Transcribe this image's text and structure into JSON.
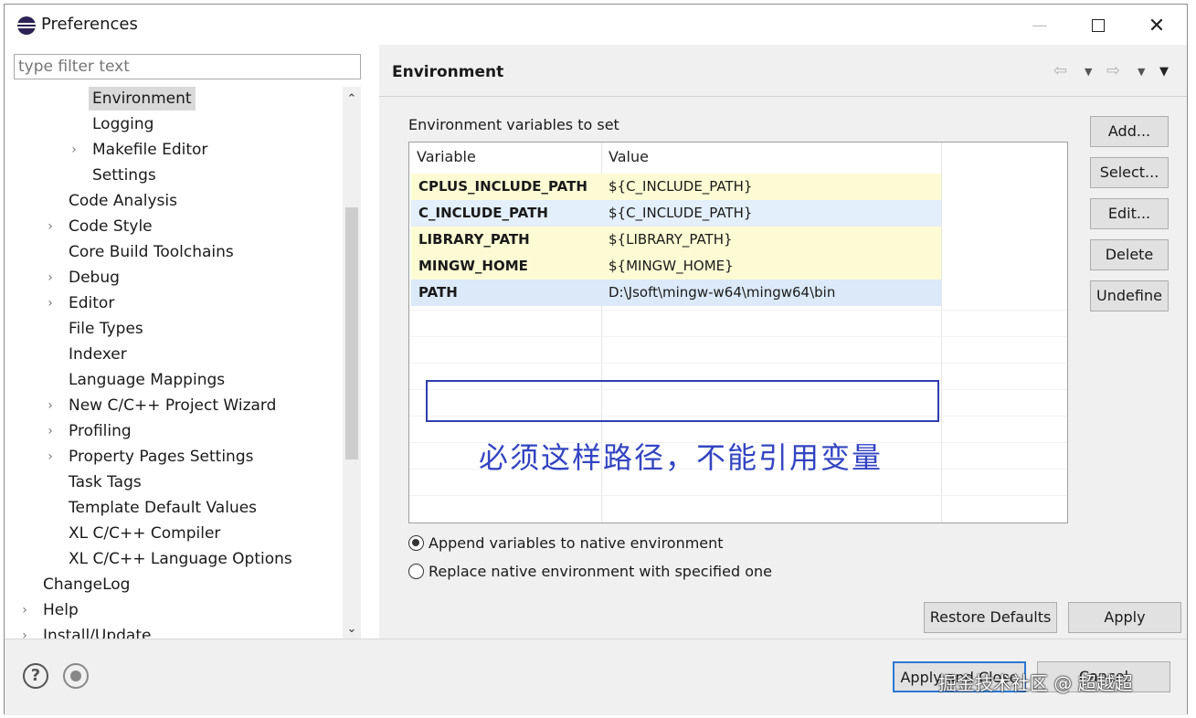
{
  "window": {
    "title": "Preferences",
    "controls": {
      "minimize": "—",
      "close": "✕"
    }
  },
  "sidebar": {
    "filter_placeholder": "type filter text",
    "items": [
      {
        "label": "Environment",
        "indent": 3,
        "expander": false,
        "selected": true
      },
      {
        "label": "Logging",
        "indent": 3,
        "expander": false
      },
      {
        "label": "Makefile Editor",
        "indent": 3,
        "expander": true
      },
      {
        "label": "Settings",
        "indent": 3,
        "expander": false
      },
      {
        "label": "Code Analysis",
        "indent": 2,
        "expander": false
      },
      {
        "label": "Code Style",
        "indent": 2,
        "expander": true
      },
      {
        "label": "Core Build Toolchains",
        "indent": 2,
        "expander": false
      },
      {
        "label": "Debug",
        "indent": 2,
        "expander": true
      },
      {
        "label": "Editor",
        "indent": 2,
        "expander": true
      },
      {
        "label": "File Types",
        "indent": 2,
        "expander": false
      },
      {
        "label": "Indexer",
        "indent": 2,
        "expander": false
      },
      {
        "label": "Language Mappings",
        "indent": 2,
        "expander": false
      },
      {
        "label": "New C/C++ Project Wizard",
        "indent": 2,
        "expander": true
      },
      {
        "label": "Profiling",
        "indent": 2,
        "expander": true
      },
      {
        "label": "Property Pages Settings",
        "indent": 2,
        "expander": true
      },
      {
        "label": "Task Tags",
        "indent": 2,
        "expander": false
      },
      {
        "label": "Template Default Values",
        "indent": 2,
        "expander": false
      },
      {
        "label": "XL C/C++ Compiler",
        "indent": 2,
        "expander": false
      },
      {
        "label": "XL C/C++ Language Options",
        "indent": 2,
        "expander": false
      },
      {
        "label": "ChangeLog",
        "indent": 1,
        "expander": false
      },
      {
        "label": "Help",
        "indent": 1,
        "expander": true
      },
      {
        "label": "Install/Update",
        "indent": 1,
        "expander": true
      }
    ]
  },
  "page": {
    "title": "Environment",
    "group_label": "Environment variables to set",
    "table": {
      "columns": [
        "Variable",
        "Value"
      ],
      "rows": [
        {
          "variable": "CPLUS_INCLUDE_PATH",
          "value": "${C_INCLUDE_PATH}",
          "bg": "#fdfbd3"
        },
        {
          "variable": "C_INCLUDE_PATH",
          "value": "${C_INCLUDE_PATH}",
          "bg": "#e3effb"
        },
        {
          "variable": "LIBRARY_PATH",
          "value": "${LIBRARY_PATH}",
          "bg": "#fdfbd3"
        },
        {
          "variable": "MINGW_HOME",
          "value": "${MINGW_HOME}",
          "bg": "#fdfbd3"
        },
        {
          "variable": "PATH",
          "value": "D:\\Jsoft\\mingw-w64\\mingw64\\bin",
          "bg": "#dbe9f8"
        }
      ]
    },
    "annotation": "必须这样路径，不能引用变量",
    "side_buttons": [
      "Add...",
      "Select...",
      "Edit...",
      "Delete",
      "Undefine"
    ],
    "radios": [
      {
        "label": "Append variables to native environment",
        "checked": true
      },
      {
        "label": "Replace native environment with specified one",
        "checked": false
      }
    ],
    "restore_defaults": "Restore Defaults",
    "apply": "Apply"
  },
  "footer": {
    "help_icon": "?",
    "apply_and_close": "Apply and Close",
    "cancel": "Cancel",
    "watermark": "掘金技术社区 @ 超越超"
  },
  "colors": {
    "annotation": "#3344c2",
    "highlight_border": "#2e3eb0",
    "default_button_border": "#2b78d4"
  }
}
